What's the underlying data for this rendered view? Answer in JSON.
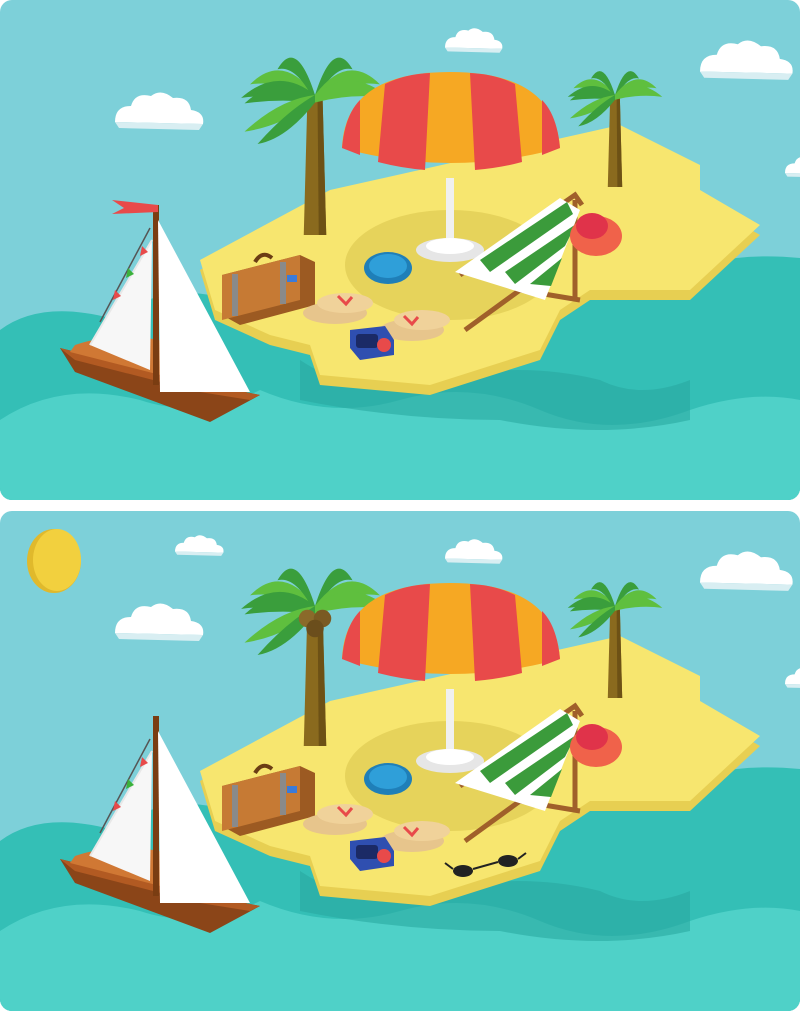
{
  "game": {
    "panels": [
      {
        "id": "top",
        "differences_present": [
          "missing-sun",
          "missing-sunglasses",
          "no-coconuts",
          "flag-on-mast"
        ]
      },
      {
        "id": "bottom",
        "differences_present": [
          "sun",
          "sunglasses",
          "coconuts",
          "no-flag"
        ]
      }
    ]
  },
  "colors": {
    "sky": "#7dd0d9",
    "sea": "#34bfb6",
    "sand": "#f7e66f",
    "umbrella_red": "#e84a4a",
    "umbrella_orange": "#f6a823",
    "palm_green": "#3a9e3c",
    "trunk": "#8a6a1e",
    "boat": "#b25a22",
    "sun": "#f2d03e"
  }
}
